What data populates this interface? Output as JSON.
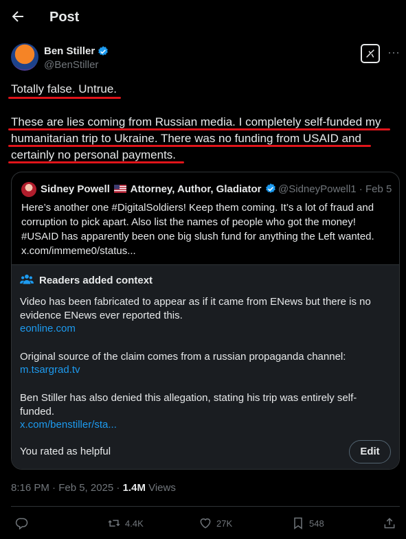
{
  "header": {
    "title": "Post"
  },
  "author": {
    "name": "Ben Stiller",
    "handle": "@BenStiller"
  },
  "post": {
    "line1": "Totally false. Untrue.",
    "line2": "These are lies coming from Russian media. I completely self-funded my",
    "line3": "humanitarian trip to Ukraine. There was no funding from USAID and",
    "line4": "certainly no personal payments."
  },
  "quote": {
    "name": "Sidney Powell",
    "title": "Attorney, Author, Gladiator",
    "handle": "@SidneyPowell1 · Feb 5",
    "text1": "Here’s another one #DigitalSoldiers! Keep them coming. It’s a lot of fraud and",
    "text2": "corruption to pick apart. Also list the names of people who got the money!",
    "text3": "#USAID has apparently been one big slush fund for anything the Left wanted.",
    "text4": "x.com/immeme0/status..."
  },
  "context": {
    "title": "Readers added context",
    "p1": "Video has been fabricated to appear as if it came from ENews but there is no evidence ENews ever reported this.",
    "link1": "eonline.com",
    "p2": "Original source of the claim comes from a russian propaganda channel:",
    "link2": "m.tsargrad.tv",
    "p3": "Ben Stiller has also denied this allegation, stating his trip was entirely self-funded.",
    "link3": "x.com/benstiller/sta...",
    "rated": "You rated as helpful",
    "edit_label": "Edit"
  },
  "meta": {
    "time": "8:16 PM · Feb 5, 2025 · ",
    "views_count": "1.4M",
    "views_label": " Views"
  },
  "actions": {
    "retweets": "4.4K",
    "likes": "27K",
    "bookmarks": "548"
  },
  "colors": {
    "accent": "#1d9bf0",
    "underline": "#e0141a",
    "background": "#000000"
  }
}
